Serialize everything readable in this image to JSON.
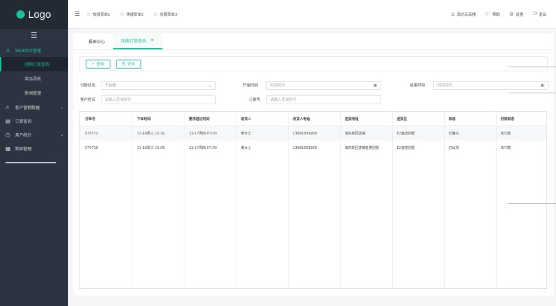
{
  "sidebar": {
    "logo_text": "Logo",
    "groups": [
      {
        "label": "WEB后台管理",
        "icon": "user-icon",
        "active": true,
        "children": [
          "团购订单查询",
          "菜品导航",
          "新闻管理"
        ]
      },
      {
        "label": "客户营销数据",
        "icon": "chart-icon"
      },
      {
        "label": "订单查询",
        "icon": "order-icon"
      },
      {
        "label": "用户统计",
        "icon": "clock-icon"
      },
      {
        "label": "新闻管理",
        "icon": "news-icon"
      }
    ]
  },
  "topbar": {
    "quick_links": [
      "快捷菜单1",
      "快捷菜单2",
      "快捷菜单3"
    ],
    "right": [
      {
        "label": "西北有高楼",
        "icon": "user-icon"
      },
      {
        "label": "帮助",
        "icon": "help-icon"
      },
      {
        "label": "设置",
        "icon": "gear-icon"
      },
      {
        "label": "退出",
        "icon": "power-icon"
      }
    ]
  },
  "tabs": [
    {
      "label": "报表中心",
      "active": false
    },
    {
      "label": "团购订单查询",
      "active": true
    }
  ],
  "toolbar": {
    "query_label": "查询",
    "export_label": "导出"
  },
  "filters": {
    "pay_status_label": "付款状态",
    "pay_status_value": "下拉框",
    "start_time_label": "开始时间",
    "start_time_placeholder": "时间控件",
    "end_time_label": "结束时间",
    "end_time_placeholder": "时间控件",
    "customer_name_label": "客户姓名",
    "customer_name_placeholder": "请输入查询条件",
    "order_no_label": "订单号",
    "order_no_placeholder": "请输入查询条件"
  },
  "table": {
    "columns": [
      "订单号",
      "下单时间",
      "要求送达时间",
      "收货人",
      "收货人电话",
      "送货地址",
      "送货区",
      "状态",
      "付款状态"
    ],
    "rows": [
      [
        "570772",
        "11-16周三 15:32",
        "11-17周四 07:00",
        "黄女士",
        "13681853959",
        "浦东新区唐镇",
        "E2金唐别墅",
        "已确认",
        "未付款"
      ],
      [
        "570728",
        "11-16周三 16:06",
        "11-17周四 07:00",
        "黄女士",
        "13681853959",
        "浦东新区唐镇金唐别墅",
        "E2金唐别墅",
        "已出货",
        "未付款"
      ]
    ]
  },
  "colors": {
    "accent": "#1ec09b",
    "sidebar_bg": "#2b3440"
  }
}
